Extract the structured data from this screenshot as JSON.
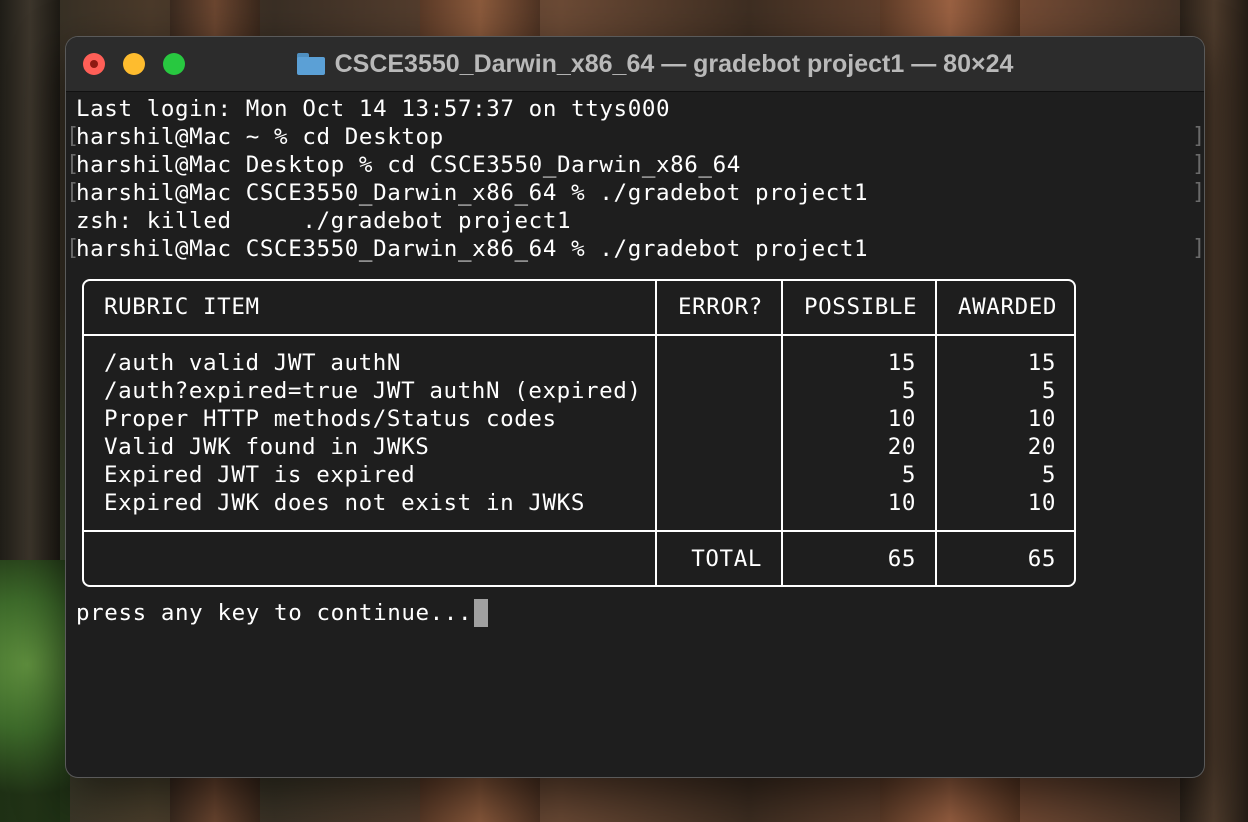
{
  "window": {
    "title": "CSCE3550_Darwin_x86_64 — gradebot project1 — 80×24"
  },
  "terminal": {
    "lines": [
      "Last login: Mon Oct 14 13:57:37 on ttys000",
      "harshil@Mac ~ % cd Desktop",
      "harshil@Mac Desktop % cd CSCE3550_Darwin_x86_64",
      "harshil@Mac CSCE3550_Darwin_x86_64 % ./gradebot project1",
      "zsh: killed     ./gradebot project1",
      "harshil@Mac CSCE3550_Darwin_x86_64 % ./gradebot project1"
    ],
    "prompt_line_markers": [
      "[",
      "]"
    ],
    "continue_prompt": "press any key to continue..."
  },
  "rubric": {
    "headers": [
      "RUBRIC ITEM",
      "ERROR?",
      "POSSIBLE",
      "AWARDED"
    ],
    "rows": [
      {
        "item": "/auth valid JWT authN",
        "error": "",
        "possible": "15",
        "awarded": "15"
      },
      {
        "item": "/auth?expired=true JWT authN (expired)",
        "error": "",
        "possible": "5",
        "awarded": "5"
      },
      {
        "item": "Proper HTTP methods/Status codes",
        "error": "",
        "possible": "10",
        "awarded": "10"
      },
      {
        "item": "Valid JWK found in JWKS",
        "error": "",
        "possible": "20",
        "awarded": "20"
      },
      {
        "item": "Expired JWT is expired",
        "error": "",
        "possible": "5",
        "awarded": "5"
      },
      {
        "item": "Expired JWK does not exist in JWKS",
        "error": "",
        "possible": "10",
        "awarded": "10"
      }
    ],
    "total_label": "TOTAL",
    "total_possible": "65",
    "total_awarded": "65"
  },
  "colors": {
    "terminal_bg": "#1e1e1e",
    "titlebar_bg": "#2c2c2c",
    "text": "#ffffff",
    "close": "#ff5f57",
    "minimize": "#febc2e",
    "zoom": "#28c840"
  }
}
